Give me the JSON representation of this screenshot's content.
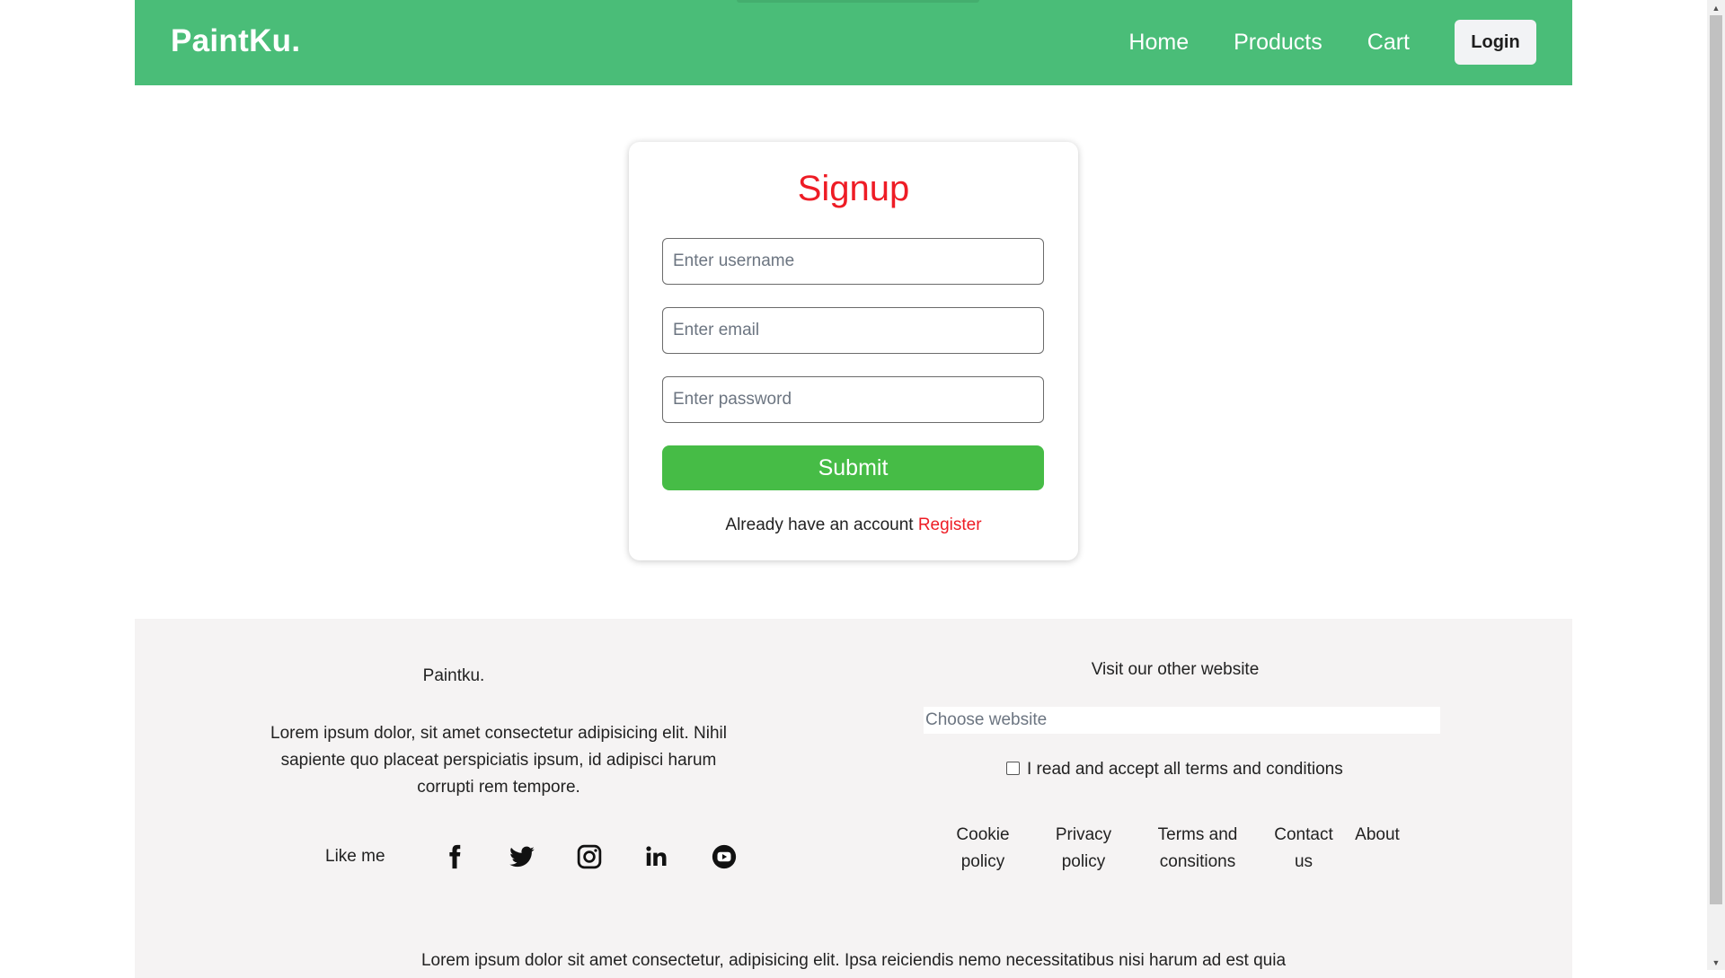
{
  "navbar": {
    "brand": "PaintKu.",
    "links": [
      "Home",
      "Products",
      "Cart"
    ],
    "login_label": "Login",
    "bg_color": "#4abd78"
  },
  "signup": {
    "title": "Signup",
    "username_placeholder": "Enter username",
    "email_placeholder": "Enter email",
    "password_placeholder": "Enter password",
    "submit_label": "Submit",
    "already_text": "Already have an account",
    "register_link": "Register",
    "title_color": "#ee1c25",
    "submit_color": "#46bc46"
  },
  "footer": {
    "brand": "Paintku.",
    "description": "Lorem ipsum dolor, sit amet consectetur adipisicing elit. Nihil sapiente quo placeat perspiciatis ipsum, id adipisci harum corrupti rem tempore.",
    "like_me": "Like me",
    "social_icons": [
      "facebook-icon",
      "twitter-icon",
      "instagram-icon",
      "linkedin-icon",
      "youtube-icon"
    ],
    "visit_title": "Visit our other website",
    "select_value": "Choose website",
    "terms_label": "I read and accept all terms and conditions",
    "links": {
      "cookie": [
        "Cookie",
        "policy"
      ],
      "privacy": [
        "Privacy",
        "policy"
      ],
      "terms": [
        "Terms and",
        "consitions"
      ],
      "contact": [
        "Contact",
        "us"
      ],
      "about": "About"
    },
    "bottom_text": "Lorem ipsum dolor sit amet consectetur, adipisicing elit. Ipsa reiciendis nemo necessitatibus nisi harum ad est quia"
  }
}
